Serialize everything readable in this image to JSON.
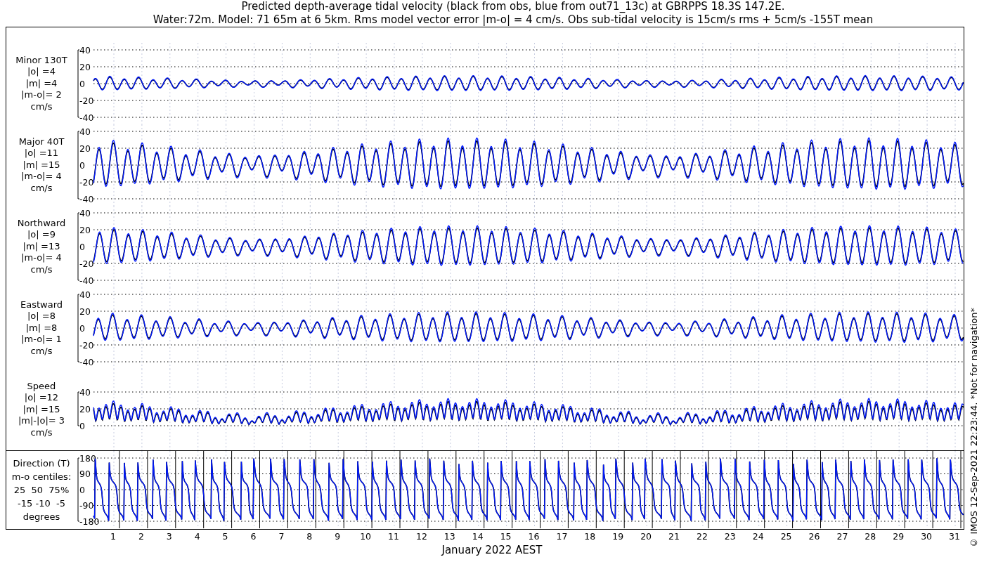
{
  "title": [
    "Predicted depth-average tidal velocity (black from obs, blue from out71_13c) at GBRPPS 18.3S 147.2E.",
    "Water:72m. Model: 71 65m at 6 5km. Rms model vector error |m-o| = 4 cm/s. Obs sub-tidal velocity is 15cm/s rms + 5cm/s -155T mean"
  ],
  "panels": [
    {
      "kind": "minor",
      "label": [
        "Minor 130T",
        "|o| =4",
        "|m| =4",
        "|m-o|= 2",
        "cm/s"
      ],
      "yticks": [
        "40",
        "20",
        "0",
        "-20",
        "-40"
      ]
    },
    {
      "kind": "major",
      "label": [
        "Major 40T",
        "|o| =11",
        "|m| =15",
        "|m-o|= 4",
        "cm/s"
      ],
      "yticks": [
        "40",
        "20",
        "0",
        "-20",
        "-40"
      ]
    },
    {
      "kind": "north",
      "label": [
        "Northward",
        "|o| =9",
        "|m| =13",
        "|m-o|= 4",
        "cm/s"
      ],
      "yticks": [
        "40",
        "20",
        "0",
        "-20",
        "-40"
      ]
    },
    {
      "kind": "east",
      "label": [
        "Eastward",
        "|o| =8",
        "|m| =8",
        "|m-o|= 1",
        "cm/s"
      ],
      "yticks": [
        "40",
        "20",
        "0",
        "-20",
        "-40"
      ]
    },
    {
      "kind": "speed",
      "label": [
        "Speed",
        "|o| =12",
        "|m| =15",
        "|m|-|o|= 3",
        "cm/s"
      ],
      "yticks": [
        "40",
        "20",
        "0"
      ]
    }
  ],
  "direction_panel": {
    "label": [
      "Direction (T)",
      "m-o centiles:",
      "25  50  75%",
      "-15 -10  -5",
      "degrees"
    ],
    "yticks": [
      "180",
      "90",
      "0",
      "-90",
      "-180"
    ]
  },
  "xticks": [
    "1",
    "2",
    "3",
    "4",
    "5",
    "6",
    "7",
    "8",
    "9",
    "10",
    "11",
    "12",
    "13",
    "14",
    "15",
    "16",
    "17",
    "18",
    "19",
    "20",
    "21",
    "22",
    "23",
    "24",
    "25",
    "26",
    "27",
    "28",
    "29",
    "30",
    "31"
  ],
  "xlabel": "January 2022 AEST",
  "credit": "© IMOS 12-Sep-2021 22:23:44. *Not for navigation*"
}
